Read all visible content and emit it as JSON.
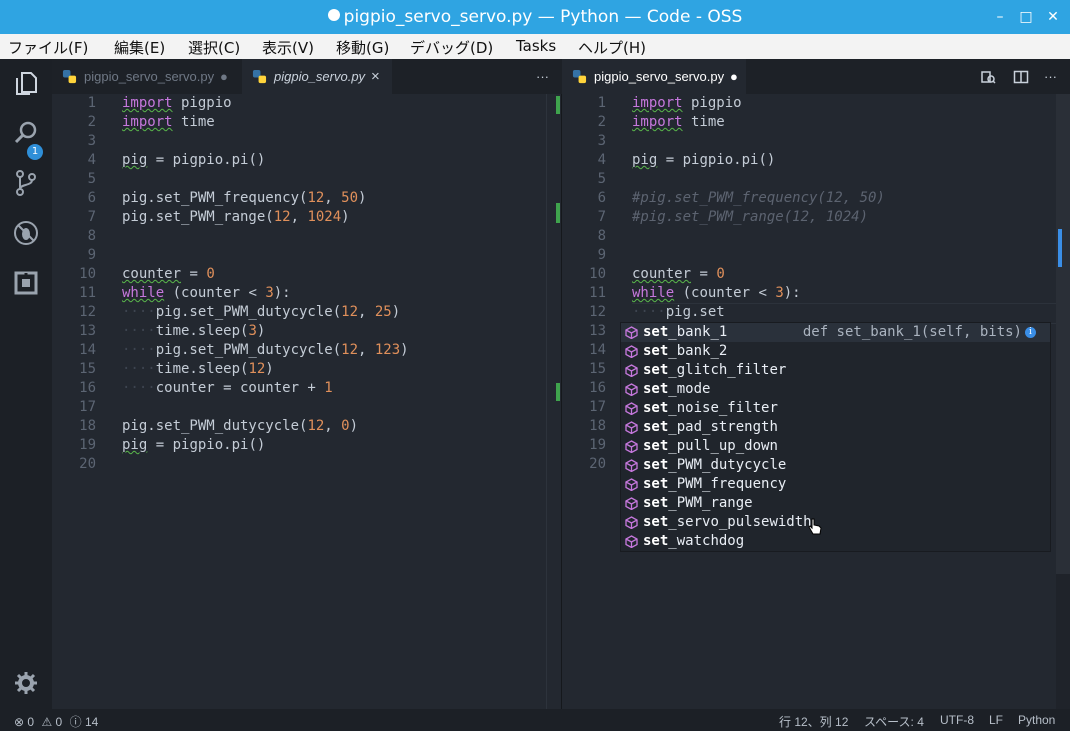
{
  "window": {
    "title": "pigpio_servo_servo.py — Python — Code - OSS",
    "min_glyph": "–",
    "max_glyph": "□",
    "close_glyph": "✕"
  },
  "menu": [
    "ファイル(F)",
    "編集(E)",
    "選択(C)",
    "表示(V)",
    "移動(G)",
    "デバッグ(D)",
    "Tasks",
    "ヘルプ(H)"
  ],
  "activity": {
    "explorer_badge": "1"
  },
  "left_pane": {
    "tabs": [
      {
        "label": "pigpio_servo_servo.py",
        "mark": "●"
      },
      {
        "label": "pigpio_servo.py",
        "mark": "×"
      }
    ],
    "more": "···",
    "lines": [
      [
        "1",
        [
          [
            "kw",
            "import"
          ],
          [
            "t",
            " pigpio"
          ]
        ]
      ],
      [
        "2",
        [
          [
            "kw",
            "import"
          ],
          [
            "t",
            " time"
          ]
        ]
      ],
      [
        "3",
        []
      ],
      [
        "4",
        [
          [
            "sq",
            "pig"
          ],
          [
            "t",
            " = pigpio.pi()"
          ]
        ]
      ],
      [
        "5",
        []
      ],
      [
        "6",
        [
          [
            "t",
            "pig.set_PWM_frequency("
          ],
          [
            "num",
            "12"
          ],
          [
            "t",
            ", "
          ],
          [
            "num",
            "50"
          ],
          [
            "t",
            ")"
          ]
        ]
      ],
      [
        "7",
        [
          [
            "t",
            "pig.set_PWM_range("
          ],
          [
            "num",
            "12"
          ],
          [
            "t",
            ", "
          ],
          [
            "num",
            "1024"
          ],
          [
            "t",
            ")"
          ]
        ]
      ],
      [
        "8",
        []
      ],
      [
        "9",
        []
      ],
      [
        "10",
        [
          [
            "sq",
            "counter"
          ],
          [
            "t",
            " = "
          ],
          [
            "num",
            "0"
          ]
        ]
      ],
      [
        "11",
        [
          [
            "kw",
            "while"
          ],
          [
            "t",
            " (counter < "
          ],
          [
            "num",
            "3"
          ],
          [
            "t",
            "):"
          ]
        ]
      ],
      [
        "12",
        [
          [
            "ws",
            "····"
          ],
          [
            "t",
            "pig.set_PWM_dutycycle("
          ],
          [
            "num",
            "12"
          ],
          [
            "t",
            ", "
          ],
          [
            "num",
            "25"
          ],
          [
            "t",
            ")"
          ]
        ]
      ],
      [
        "13",
        [
          [
            "ws",
            "····"
          ],
          [
            "t",
            "time.sleep("
          ],
          [
            "num",
            "3"
          ],
          [
            "t",
            ")"
          ]
        ]
      ],
      [
        "14",
        [
          [
            "ws",
            "····"
          ],
          [
            "t",
            "pig.set_PWM_dutycycle("
          ],
          [
            "num",
            "12"
          ],
          [
            "t",
            ", "
          ],
          [
            "num",
            "123"
          ],
          [
            "t",
            ")"
          ]
        ]
      ],
      [
        "15",
        [
          [
            "ws",
            "····"
          ],
          [
            "t",
            "time.sleep("
          ],
          [
            "num",
            "12"
          ],
          [
            "t",
            ")"
          ]
        ]
      ],
      [
        "16",
        [
          [
            "ws",
            "····"
          ],
          [
            "t",
            "counter = counter + "
          ],
          [
            "num",
            "1"
          ]
        ]
      ],
      [
        "17",
        []
      ],
      [
        "18",
        [
          [
            "t",
            "pig.set_PWM_dutycycle("
          ],
          [
            "num",
            "12"
          ],
          [
            "t",
            ", "
          ],
          [
            "num",
            "0"
          ],
          [
            "t",
            ")"
          ]
        ]
      ],
      [
        "19",
        [
          [
            "sq",
            "pig"
          ],
          [
            "t",
            " = pigpio.pi()"
          ]
        ]
      ],
      [
        "20",
        []
      ]
    ]
  },
  "right_pane": {
    "tabs": [
      {
        "label": "pigpio_servo_servo.py",
        "mark": "●"
      }
    ],
    "more": "···",
    "lines": [
      [
        "1",
        [
          [
            "kw",
            "import"
          ],
          [
            "t",
            " pigpio"
          ]
        ]
      ],
      [
        "2",
        [
          [
            "kw",
            "import"
          ],
          [
            "t",
            " time"
          ]
        ]
      ],
      [
        "3",
        []
      ],
      [
        "4",
        [
          [
            "sq",
            "pig"
          ],
          [
            "t",
            " = pigpio.pi()"
          ]
        ]
      ],
      [
        "5",
        []
      ],
      [
        "6",
        [
          [
            "cm",
            "#pig.set_PWM_frequency(12, 50)"
          ]
        ]
      ],
      [
        "7",
        [
          [
            "cm",
            "#pig.set_PWM_range(12, 1024)"
          ]
        ]
      ],
      [
        "8",
        []
      ],
      [
        "9",
        []
      ],
      [
        "10",
        [
          [
            "sq",
            "counter"
          ],
          [
            "t",
            " = "
          ],
          [
            "num",
            "0"
          ]
        ]
      ],
      [
        "11",
        [
          [
            "kw",
            "while"
          ],
          [
            "t",
            " (counter < "
          ],
          [
            "num",
            "3"
          ],
          [
            "t",
            "):"
          ]
        ]
      ],
      [
        "12",
        [
          [
            "ws",
            "····"
          ],
          [
            "t",
            "pig.set"
          ]
        ]
      ],
      [
        "13",
        []
      ],
      [
        "14",
        []
      ],
      [
        "15",
        []
      ],
      [
        "16",
        []
      ],
      [
        "17",
        []
      ],
      [
        "18",
        []
      ],
      [
        "19",
        []
      ],
      [
        "20",
        []
      ]
    ]
  },
  "suggest": {
    "prefix": "set",
    "items": [
      {
        "rest": "_bank_1",
        "detail": "def set_bank_1(self, bits)",
        "info": "i"
      },
      {
        "rest": "_bank_2"
      },
      {
        "rest": "_glitch_filter"
      },
      {
        "rest": "_mode"
      },
      {
        "rest": "_noise_filter"
      },
      {
        "rest": "_pad_strength"
      },
      {
        "rest": "_pull_up_down"
      },
      {
        "rest": "_PWM_dutycycle"
      },
      {
        "rest": "_PWM_frequency"
      },
      {
        "rest": "_PWM_range"
      },
      {
        "rest": "_servo_pulsewidth"
      },
      {
        "rest": "_watchdog"
      }
    ]
  },
  "status": {
    "errors": "0",
    "warnings": "0",
    "infos": "14",
    "position": "行 12、列 12",
    "spaces": "スペース: 4",
    "encoding": "UTF-8",
    "eol": "LF",
    "language": "Python"
  },
  "colors": {
    "title_bar": "#2fa4e2",
    "keyword": "#c678dd",
    "number": "#e0905b",
    "added_gutter": "#3fa34d",
    "badge": "#2f8fd8"
  }
}
